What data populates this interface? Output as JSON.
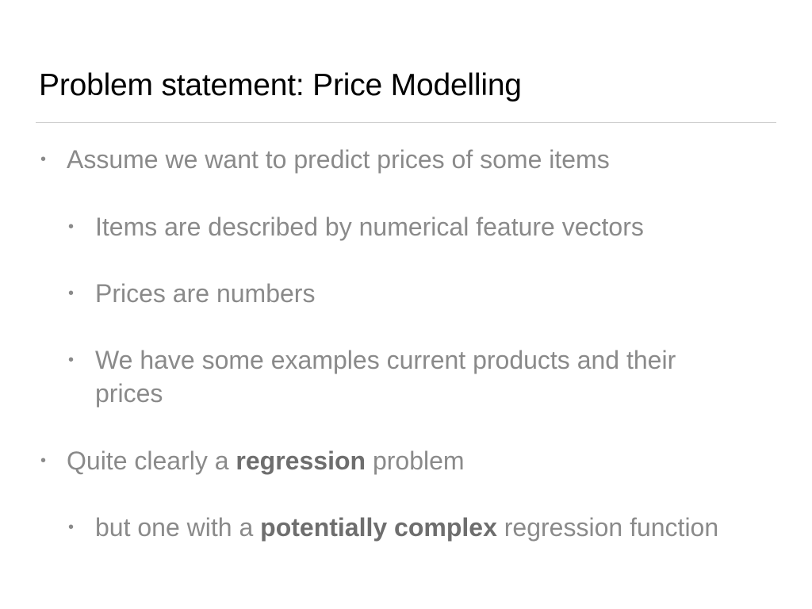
{
  "slide": {
    "title": "Problem statement: Price Modelling",
    "bullet_glyph": "•",
    "bullets": [
      {
        "level": 1,
        "text": "Assume we want to predict prices of some items"
      },
      {
        "level": 2,
        "text": "Items are described by numerical feature vectors"
      },
      {
        "level": 2,
        "text": "Prices are numbers"
      },
      {
        "level": 2,
        "line1": "We have some examples current products and their",
        "line2": "prices"
      },
      {
        "level": 1,
        "before": "Quite clearly a ",
        "bold": "regression",
        "after": " problem"
      },
      {
        "level": 2,
        "before": "but one with a ",
        "bold": "potentially complex",
        "after": " regression function"
      }
    ]
  }
}
